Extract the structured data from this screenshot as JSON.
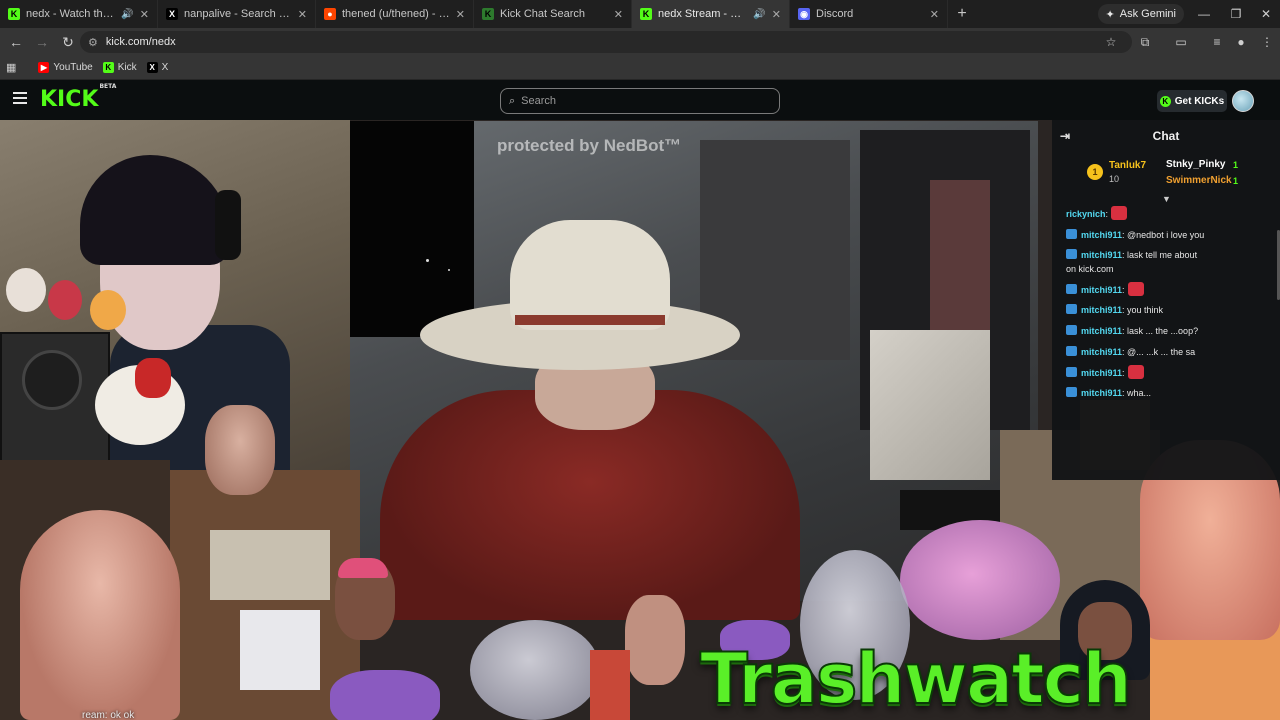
{
  "browser": {
    "tabs": [
      {
        "title": "nedx - Watch the VOD on",
        "favicon": "kick",
        "color": "#53fc18",
        "audio": true
      },
      {
        "title": "nanpalive - Search / X",
        "favicon": "x",
        "color": "#000000",
        "audio": false
      },
      {
        "title": "thened (u/thened) - Reddit",
        "favicon": "reddit",
        "color": "#ff4500",
        "audio": false
      },
      {
        "title": "Kick Chat Search",
        "favicon": "kick-chat",
        "color": "#2d7a2d",
        "audio": false
      },
      {
        "title": "nedx Stream - Watch Live o",
        "favicon": "kick",
        "color": "#53fc18",
        "audio": true,
        "active": true
      },
      {
        "title": "Discord",
        "favicon": "discord",
        "color": "#5865f2",
        "audio": false
      }
    ],
    "new_tab_label": "+",
    "gemini_label": "Ask Gemini",
    "url": "kick.com/nedx",
    "bookmarks": [
      {
        "label": "YouTube",
        "icon": "youtube-icon",
        "color": "#ff0000"
      },
      {
        "label": "Kick",
        "icon": "kick-icon",
        "color": "#53fc18"
      },
      {
        "label": "X",
        "icon": "x-icon",
        "color": "#ffffff"
      }
    ]
  },
  "kick": {
    "logo": "KICK",
    "logo_sup": "BETA",
    "search_placeholder": "Search",
    "get_kicks_label": "Get KICKs"
  },
  "stream": {
    "watermark": "protected by NedBot™",
    "overlay_title": "Trashwatch",
    "ghost_chat": "ream: ok ok"
  },
  "chat": {
    "title": "Chat",
    "leaderboard": {
      "rank": "1",
      "top_user": "Tanluk7",
      "top_count": "10",
      "entries": [
        {
          "name": "Stnky_Pinky",
          "gift": "1",
          "color": "#ffffff"
        },
        {
          "name": "SwimmerNick",
          "gift": "1",
          "color": "#f0a030"
        }
      ]
    },
    "messages": [
      {
        "user": "rickynich",
        "text": ":",
        "user_color": "#53d8f0",
        "emote": true
      },
      {
        "user": "mitchi911",
        "text": ": @nedbot i love you",
        "user_color": "#53d8f0"
      },
      {
        "user": "mitchi911",
        "text": ": lask tell me about",
        "user_color": "#53d8f0"
      },
      {
        "user": "",
        "text": "on kick.com",
        "user_color": "#53d8f0"
      },
      {
        "user": "mitchi911",
        "text": ":",
        "user_color": "#53d8f0",
        "emote": true
      },
      {
        "user": "mitchi911",
        "text": ": you think",
        "user_color": "#53d8f0"
      },
      {
        "user": "mitchi911",
        "text": ": lask ... the ...oop?",
        "user_color": "#53d8f0"
      },
      {
        "user": "mitchi911",
        "text": ": @... ...k ... the sa",
        "user_color": "#53d8f0"
      },
      {
        "user": "mitchi911",
        "text": ":",
        "user_color": "#53d8f0",
        "emote": true
      },
      {
        "user": "mitchi911",
        "text": ": wha...",
        "user_color": "#53d8f0"
      }
    ]
  }
}
